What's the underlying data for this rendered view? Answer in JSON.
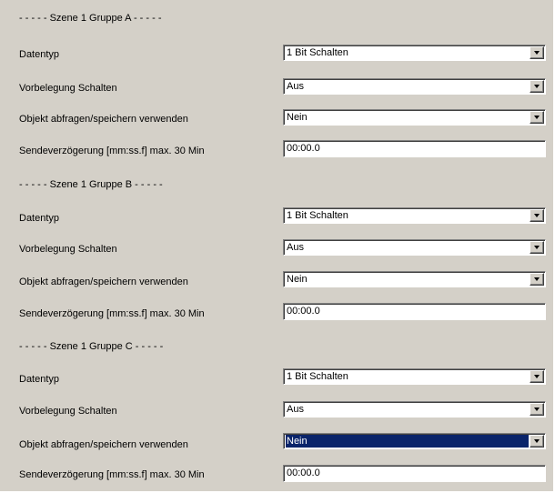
{
  "colors": {
    "panel_background": "#d4d0c8",
    "field_background": "#ffffff",
    "selection_highlight": "#0a246a",
    "selection_text": "#ffffff"
  },
  "icons": {
    "dropdown_button": "chevron-down-icon"
  },
  "groups": [
    {
      "header": "- - - - - Szene 1  Gruppe A - - - - -",
      "rows": {
        "datentyp": {
          "label": "Datentyp",
          "value": "1 Bit Schalten"
        },
        "vorbelegung": {
          "label": "Vorbelegung Schalten",
          "value": "Aus"
        },
        "objekt": {
          "label": "Objekt abfragen/speichern verwenden",
          "value": "Nein"
        },
        "sendeverzoegerung": {
          "label": "Sendeverzögerung [mm:ss.f] max. 30 Min",
          "value": "00:00.0"
        }
      }
    },
    {
      "header": "- - - - - Szene 1  Gruppe B - - - - -",
      "rows": {
        "datentyp": {
          "label": "Datentyp",
          "value": "1 Bit Schalten"
        },
        "vorbelegung": {
          "label": "Vorbelegung Schalten",
          "value": "Aus"
        },
        "objekt": {
          "label": "Objekt abfragen/speichern verwenden",
          "value": "Nein"
        },
        "sendeverzoegerung": {
          "label": "Sendeverzögerung [mm:ss.f] max. 30 Min",
          "value": "00:00.0"
        }
      }
    },
    {
      "header": "- - - - - Szene 1  Gruppe C - - - - -",
      "rows": {
        "datentyp": {
          "label": "Datentyp",
          "value": "1 Bit Schalten"
        },
        "vorbelegung": {
          "label": "Vorbelegung Schalten",
          "value": "Aus"
        },
        "objekt": {
          "label": "Objekt abfragen/speichern verwenden",
          "value": "Nein",
          "selected": true
        },
        "sendeverzoegerung": {
          "label": "Sendeverzögerung [mm:ss.f] max. 30 Min",
          "value": "00:00.0"
        }
      }
    }
  ]
}
